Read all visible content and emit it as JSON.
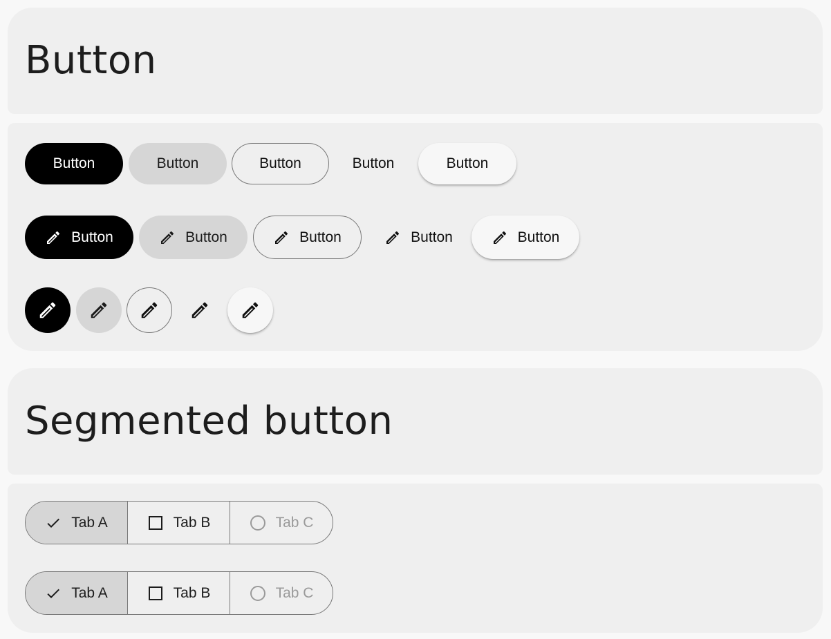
{
  "sections": {
    "button": {
      "title": "Button"
    },
    "segmented": {
      "title": "Segmented button"
    }
  },
  "buttons": {
    "label": "Button",
    "variants": [
      "filled",
      "tonal",
      "outlined",
      "text",
      "elevated"
    ],
    "icon": "pencil-icon"
  },
  "segmented": {
    "rows": [
      {
        "tabs": [
          {
            "label": "Tab A",
            "icon": "check-icon",
            "selected": true,
            "disabled": false
          },
          {
            "label": "Tab B",
            "icon": "square-icon",
            "selected": false,
            "disabled": false
          },
          {
            "label": "Tab C",
            "icon": "circle-icon",
            "selected": false,
            "disabled": true
          }
        ]
      },
      {
        "tabs": [
          {
            "label": "Tab A",
            "icon": "check-icon",
            "selected": true,
            "disabled": false
          },
          {
            "label": "Tab B",
            "icon": "square-icon",
            "selected": false,
            "disabled": false
          },
          {
            "label": "Tab C",
            "icon": "circle-icon",
            "selected": false,
            "disabled": true
          }
        ]
      }
    ]
  },
  "colors": {
    "page_bg": "#f8f8f8",
    "card_bg": "#efefef",
    "filled": "#000000",
    "tonal": "#d6d6d6",
    "outline": "#777777",
    "disabled_text": "#9a9a9a"
  }
}
